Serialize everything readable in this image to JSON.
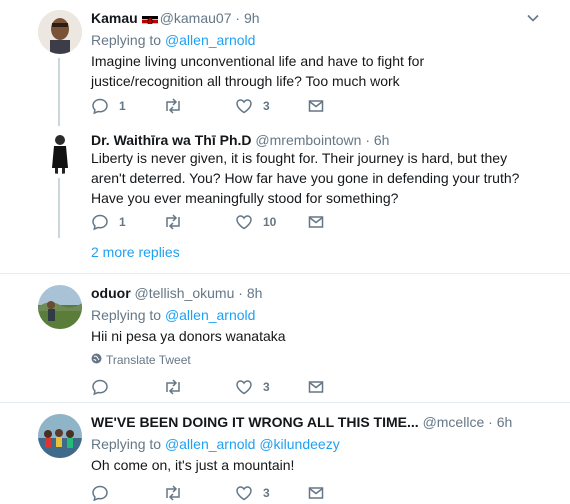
{
  "tweets": [
    {
      "name": "Kamau",
      "has_flag": true,
      "handle": "@kamau07",
      "time": "9h",
      "replying_to_label": "Replying to",
      "replying_to": [
        "@allen_arnold"
      ],
      "text": "Imagine living unconventional life and have to fight for justice/recognition all through life? Too much work",
      "replies": "1",
      "retweets": "",
      "likes": "3"
    },
    {
      "name": "Dr. Waithīra wa Thī Ph.D",
      "handle": "@mrembointown",
      "time": "6h",
      "text": "Liberty is never given, it is fought for. Their journey is hard, but they aren't deterred. You? How far have you gone in defending your truth? Have you ever meaningfully stood for something?",
      "replies": "1",
      "retweets": "",
      "likes": "10"
    },
    {
      "name": "oduor",
      "handle": "@tellish_okumu",
      "time": "8h",
      "replying_to_label": "Replying to",
      "replying_to": [
        "@allen_arnold"
      ],
      "text": "Hii ni pesa ya donors wanataka",
      "translate": "Translate Tweet",
      "replies": "",
      "retweets": "",
      "likes": "3"
    },
    {
      "name": "WE'VE BEEN DOING IT WRONG ALL THIS TIME...",
      "handle": "@mcellce",
      "time": "6h",
      "replying_to_label": "Replying to",
      "replying_to": [
        "@allen_arnold",
        "@kilundeezy"
      ],
      "text": "Oh come on, it's just a mountain!",
      "replies": "",
      "retweets": "",
      "likes": "3"
    }
  ],
  "more_replies": "2 more replies",
  "dot": "·",
  "colors": {
    "link": "#1da1f2",
    "muted": "#657786",
    "text": "#14171a",
    "divider": "#e6ecf0"
  },
  "icons": [
    "reply-icon",
    "retweet-icon",
    "like-icon",
    "message-icon",
    "chevron-down-icon",
    "globe-icon",
    "kenya-flag-icon"
  ]
}
